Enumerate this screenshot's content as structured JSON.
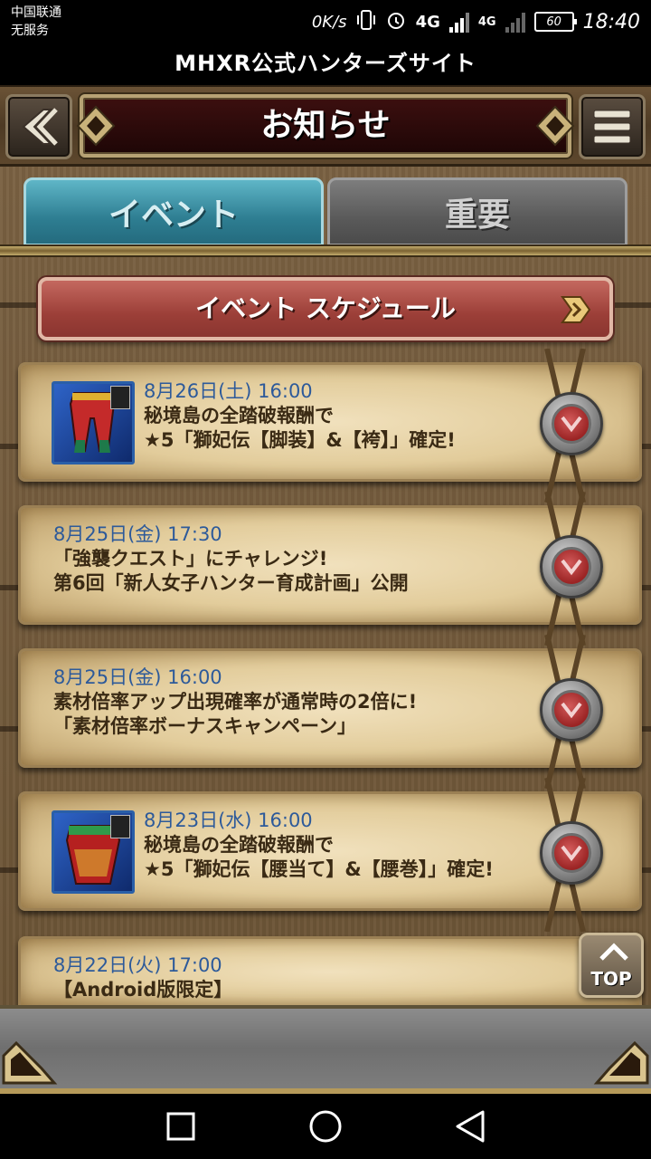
{
  "status_bar": {
    "carrier_line1": "中国联通",
    "carrier_line2": "无服务",
    "speed": "0K/s",
    "network1": "4G",
    "network2": "4G",
    "battery": "60",
    "time": "18:40"
  },
  "site_title": "MHXR公式ハンターズサイト",
  "header": {
    "title": "お知らせ",
    "back_icon": "back-arrow-icon",
    "menu_icon": "hamburger-menu-icon"
  },
  "tabs": [
    {
      "label": "イベント",
      "active": true
    },
    {
      "label": "重要",
      "active": false
    }
  ],
  "schedule_button": {
    "label": "イベント スケジュール"
  },
  "news": [
    {
      "date": "8月26日(土) 16:00",
      "line1": "秘境島の全踏破報酬で",
      "line2": "★5「獅妃伝【脚装】&【袴】」確定!",
      "thumbnail": "red-pants-armor"
    },
    {
      "date": "8月25日(金) 17:30",
      "line1": "「強襲クエスト」にチャレンジ!",
      "line2": "第6回「新人女子ハンター育成計画」公開",
      "thumbnail": null
    },
    {
      "date": "8月25日(金) 16:00",
      "line1": "素材倍率アップ出現確率が通常時の2倍に!",
      "line2": "「素材倍率ボーナスキャンペーン」",
      "thumbnail": null
    },
    {
      "date": "8月23日(水) 16:00",
      "line1": "秘境島の全踏破報酬で",
      "line2": "★5「獅妃伝【腰当て】&【腰巻】」確定!",
      "thumbnail": "red-waist-armor"
    },
    {
      "date": "8月22日(火) 17:00",
      "line1": "【Android版限定】",
      "line2": "",
      "thumbnail": null
    }
  ],
  "top_button": {
    "label": "TOP"
  },
  "colors": {
    "tab_active": "#2e7e92",
    "tab_inactive": "#5a5a5a",
    "schedule_red": "#9c3f38",
    "date_blue": "#2d5a9a",
    "parchment": "#e2cc9b"
  }
}
